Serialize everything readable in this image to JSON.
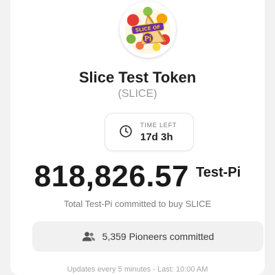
{
  "token": {
    "logo_text_top": "SLICE OF",
    "logo_text_bottom": "Pi",
    "name": "Slice Test Token",
    "symbol": "(SLICE)"
  },
  "timer": {
    "label": "TIME LEFT",
    "value": "17d 3h",
    "icon": "clock-icon"
  },
  "commitment": {
    "amount": "818,826.57",
    "unit": "Test-Pi",
    "caption": "Total Test-Pi committed to buy SLICE"
  },
  "pioneers": {
    "icon": "users-icon",
    "text": "5,359 Pioneers committed"
  },
  "footer": {
    "updates": "Updates every 5 minutes - Last: 10:00 AM"
  },
  "colors": {
    "logo_purple": "#6b2fa0",
    "logo_yellow": "#f4c531",
    "text_dark": "#1f1f1f",
    "text_muted": "#9a9a9a",
    "pill_bg": "#f1f1f2"
  }
}
